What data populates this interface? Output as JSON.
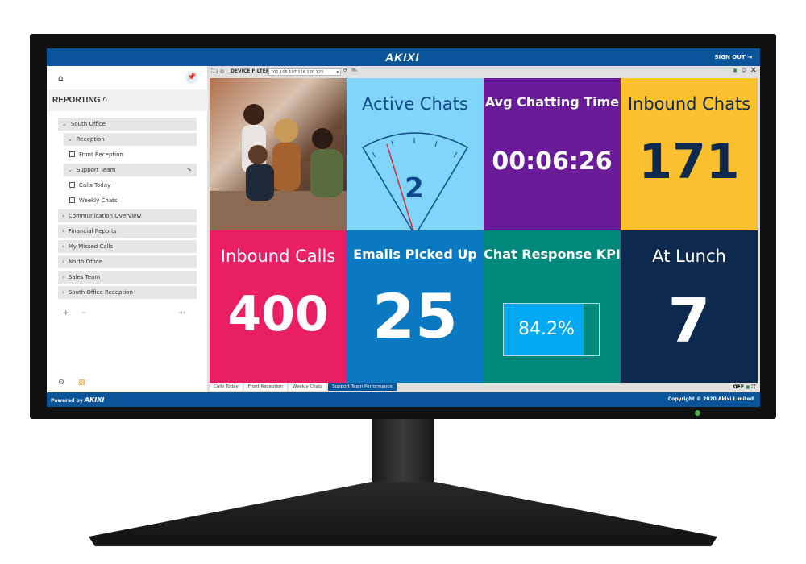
{
  "header": {
    "logo": "AKIXI",
    "sign_out": "SIGN OUT"
  },
  "sidebar": {
    "section": "REPORTING",
    "items": [
      {
        "label": "South Office",
        "type": "group",
        "expanded": true
      },
      {
        "label": "Reception",
        "type": "subgroup",
        "expanded": true
      },
      {
        "label": "Front Reception",
        "type": "leaf"
      },
      {
        "label": "Support Team",
        "type": "subgroup",
        "expanded": true
      },
      {
        "label": "Calls Today",
        "type": "leaf"
      },
      {
        "label": "Weekly Chats",
        "type": "leaf"
      },
      {
        "label": "Communication Overview",
        "type": "group"
      },
      {
        "label": "Financial Reports",
        "type": "group"
      },
      {
        "label": "My Missed Calls",
        "type": "group"
      },
      {
        "label": "North Office",
        "type": "group"
      },
      {
        "label": "Sales Team",
        "type": "group"
      },
      {
        "label": "South Office Reception",
        "type": "group"
      }
    ],
    "add": "+",
    "remove": "−",
    "more": "···"
  },
  "toolbar": {
    "filter_label": "DEVICE FILTER:",
    "filter_value": "101,105,107,116,120,122"
  },
  "tiles": [
    {
      "title": "Active Chats",
      "value": "2",
      "color": "#81d4fa",
      "text": "#0d4a8a"
    },
    {
      "title": "Avg Chatting Time",
      "value": "00:06:26",
      "color": "#6a1b9a"
    },
    {
      "title": "Inbound Chats",
      "value": "171",
      "color": "#fbc02d",
      "text": "#0d2a4e"
    },
    {
      "title": "Inbound Calls",
      "value": "400",
      "color": "#e91e63"
    },
    {
      "title": "Emails Picked Up",
      "value": "25",
      "color": "#0b78c2"
    },
    {
      "title": "Chat Response KPI",
      "value": "84.2%",
      "percent": 84.2,
      "color": "#00897b"
    },
    {
      "title": "At Lunch",
      "value": "7",
      "color": "#0d2a4e"
    }
  ],
  "tabs": [
    "Calls Today",
    "Front Reception",
    "Weekly Chats",
    "Support Team Performance"
  ],
  "active_tab": "Support Team Performance",
  "status": {
    "off": "OFF"
  },
  "footer": {
    "powered": "Powered by",
    "brand": "AKIXI",
    "copyright": "Copyright © 2020 Akixi Limited"
  }
}
